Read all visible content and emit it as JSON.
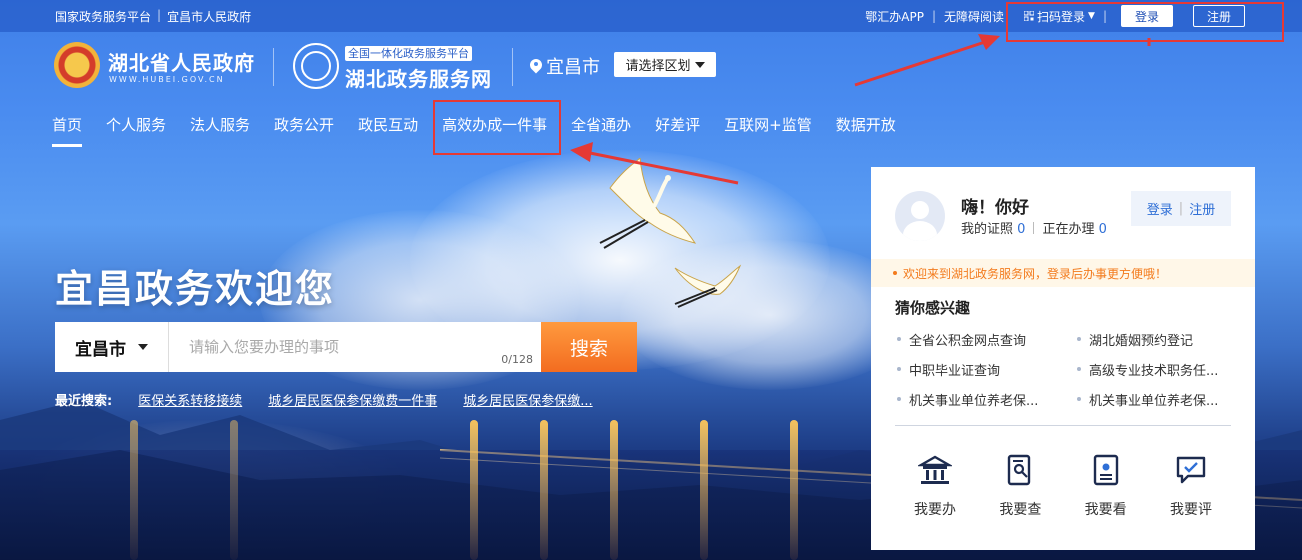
{
  "topbar": {
    "left_links": [
      "国家政务服务平台",
      "宜昌市人民政府"
    ],
    "app_link": "鄂汇办APP",
    "accessibility": "无障碍阅读",
    "qr_login": "扫码登录",
    "login": "登录",
    "register": "注册"
  },
  "header": {
    "gov_name": "湖北省人民政府",
    "gov_url": "WWW.HUBEI.GOV.CN",
    "svc_tag": "全国一体化政务服务平台",
    "svc_name": "湖北政务服务网",
    "city": "宜昌市",
    "region_select": "请选择区划"
  },
  "nav": {
    "items": [
      "首页",
      "个人服务",
      "法人服务",
      "政务公开",
      "政民互动",
      "高效办成一件事",
      "全省通办",
      "好差评",
      "互联网+监管",
      "数据开放"
    ]
  },
  "hero": {
    "title": "宜昌政务欢迎您",
    "search_city": "宜昌市",
    "search_placeholder": "请输入您要办理的事项",
    "search_counter": "0/128",
    "search_button": "搜索",
    "recent_label": "最近搜索:",
    "recent_items": [
      "医保关系转移接续",
      "城乡居民医保参保缴费一件事",
      "城乡居民医保参保缴..."
    ]
  },
  "panel": {
    "hello": "嗨！你好",
    "my_certs": "我的证照",
    "certs_count": "0",
    "in_progress": "正在办理",
    "progress_count": "0",
    "login": "登录",
    "register": "注册",
    "notice": "欢迎来到湖北政务服务网，登录后办事更方便哦！",
    "guess_title": "猜你感兴趣",
    "guess_items": [
      "全省公积金网点查询",
      "湖北婚姻预约登记",
      "中职毕业证查询",
      "高级专业技术职务任...",
      "机关事业单位养老保...",
      "机关事业单位养老保..."
    ],
    "actions": [
      {
        "label": "我要办",
        "icon": "government-building-icon"
      },
      {
        "label": "我要查",
        "icon": "search-document-icon"
      },
      {
        "label": "我要看",
        "icon": "view-document-icon"
      },
      {
        "label": "我要评",
        "icon": "review-chat-icon"
      }
    ]
  },
  "colors": {
    "accent_blue": "#2f6fd6",
    "search_orange": "#f36c20",
    "annotation_red": "#e53935",
    "notice_orange": "#f37b1d"
  }
}
